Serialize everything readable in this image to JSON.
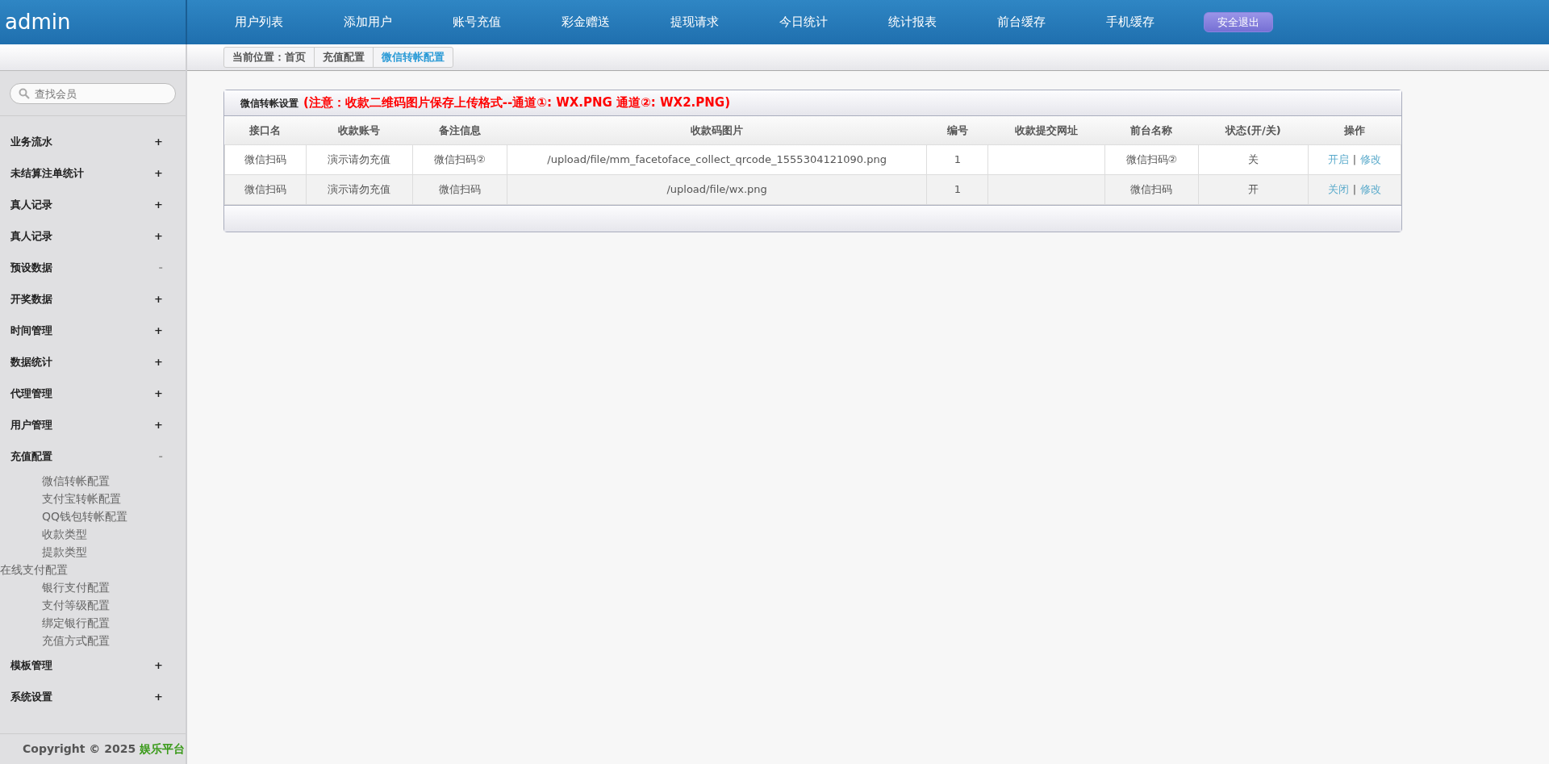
{
  "brand": "admin",
  "top_nav": [
    {
      "label": "用户列表"
    },
    {
      "label": "添加用户"
    },
    {
      "label": "账号充值"
    },
    {
      "label": "彩金赠送"
    },
    {
      "label": "提现请求"
    },
    {
      "label": "今日统计"
    },
    {
      "label": "统计报表"
    },
    {
      "label": "前台缓存"
    },
    {
      "label": "手机缓存"
    }
  ],
  "logout_button": "安全退出",
  "breadcrumb": [
    "当前位置：首页",
    "充值配置",
    "微信转帐配置"
  ],
  "sidebar": {
    "search_placeholder": "查找会员",
    "items": [
      {
        "label": "业务流水",
        "toggle": "+",
        "expanded": false
      },
      {
        "label": "未结算注单统计",
        "toggle": "+",
        "expanded": false
      },
      {
        "label": "真人记录",
        "toggle": "+",
        "expanded": false
      },
      {
        "label": "真人记录",
        "toggle": "+",
        "expanded": false
      },
      {
        "label": "预设数据",
        "toggle": "-",
        "expanded": true
      },
      {
        "label": "开奖数据",
        "toggle": "+",
        "expanded": false
      },
      {
        "label": "时间管理",
        "toggle": "+",
        "expanded": false
      },
      {
        "label": "数据统计",
        "toggle": "+",
        "expanded": false
      },
      {
        "label": "代理管理",
        "toggle": "+",
        "expanded": false
      },
      {
        "label": "用户管理",
        "toggle": "+",
        "expanded": false
      },
      {
        "label": "充值配置",
        "toggle": "-",
        "expanded": true,
        "children": [
          {
            "label": "微信转帐配置",
            "kind": "link"
          },
          {
            "label": "支付宝转帐配置",
            "kind": "link"
          },
          {
            "label": "QQ钱包转帐配置",
            "kind": "link"
          },
          {
            "label": "收款类型",
            "kind": "link"
          },
          {
            "label": "提款类型",
            "kind": "link"
          },
          {
            "label": "在线支付配置",
            "kind": "heading"
          },
          {
            "label": "银行支付配置",
            "kind": "link"
          },
          {
            "label": "支付等级配置",
            "kind": "link"
          },
          {
            "label": "绑定银行配置",
            "kind": "link"
          },
          {
            "label": "充值方式配置",
            "kind": "link"
          }
        ]
      },
      {
        "label": "模板管理",
        "toggle": "+",
        "expanded": false
      },
      {
        "label": "系统设置",
        "toggle": "+",
        "expanded": false
      }
    ],
    "copyright": "Copyright © 2025",
    "copyright_link": "娱乐平台"
  },
  "panel": {
    "title": "微信转帐设置",
    "notice": "(注意：收款二维码图片保存上传格式--通道①: WX.PNG 通道②: WX2.PNG)",
    "table": {
      "columns": [
        "接口名",
        "收款账号",
        "备注信息",
        "收款码图片",
        "编号",
        "收款提交网址",
        "前台名称",
        "状态(开/关)",
        "操作"
      ],
      "rows": [
        {
          "cells": [
            "微信扫码",
            "演示请勿充值",
            "微信扫码②",
            "/upload/file/mm_facetoface_collect_qrcode_1555304121090.png",
            "1",
            "",
            "微信扫码②",
            "关"
          ],
          "actions": [
            "开启",
            "修改"
          ],
          "separator": "|"
        },
        {
          "cells": [
            "微信扫码",
            "演示请勿充值",
            "微信扫码",
            "/upload/file/wx.png",
            "1",
            "",
            "微信扫码",
            "开"
          ],
          "actions": [
            "关闭",
            "修改"
          ],
          "separator": "|"
        }
      ]
    }
  }
}
